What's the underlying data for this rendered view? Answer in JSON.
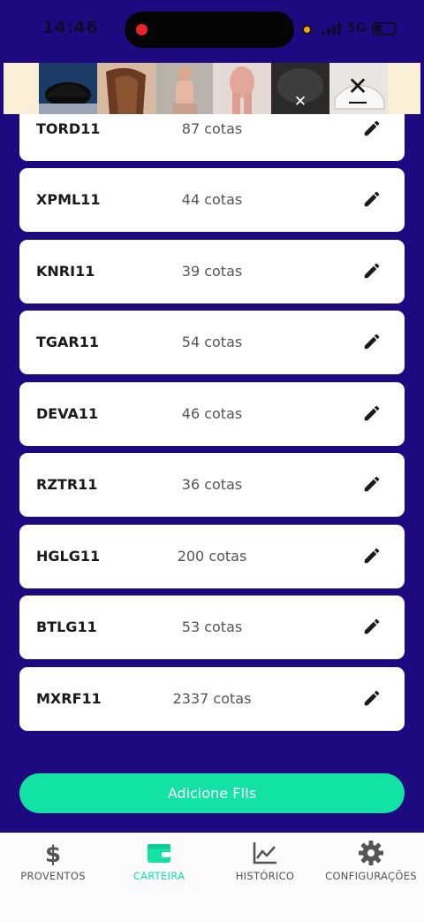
{
  "status_bar": {
    "time": "14:46",
    "network": "5G"
  },
  "fiis": [
    {
      "ticker": "TORD11",
      "quantity": "87 cotas"
    },
    {
      "ticker": "XPML11",
      "quantity": "44 cotas"
    },
    {
      "ticker": "KNRI11",
      "quantity": "39 cotas"
    },
    {
      "ticker": "TGAR11",
      "quantity": "54 cotas"
    },
    {
      "ticker": "DEVA11",
      "quantity": "46 cotas"
    },
    {
      "ticker": "RZTR11",
      "quantity": "36 cotas"
    },
    {
      "ticker": "HGLG11",
      "quantity": "200 cotas"
    },
    {
      "ticker": "BTLG11",
      "quantity": "53 cotas"
    },
    {
      "ticker": "MXRF11",
      "quantity": "2337 cotas"
    }
  ],
  "add_button": {
    "label": "Adicione FIIs"
  },
  "bottom_nav": [
    {
      "label": "PROVENTOS",
      "icon": "dollar-icon",
      "active": false
    },
    {
      "label": "CARTEIRA",
      "icon": "wallet-icon",
      "active": true
    },
    {
      "label": "HISTÓRICO",
      "icon": "chart-line-icon",
      "active": false
    },
    {
      "label": "CONFIGURAÇÕES",
      "icon": "gear-icon",
      "active": false
    }
  ],
  "colors": {
    "background": "#1d0a80",
    "accent": "#13e2a5",
    "card": "#ffffff",
    "nav_background": "#fbfbfb"
  }
}
